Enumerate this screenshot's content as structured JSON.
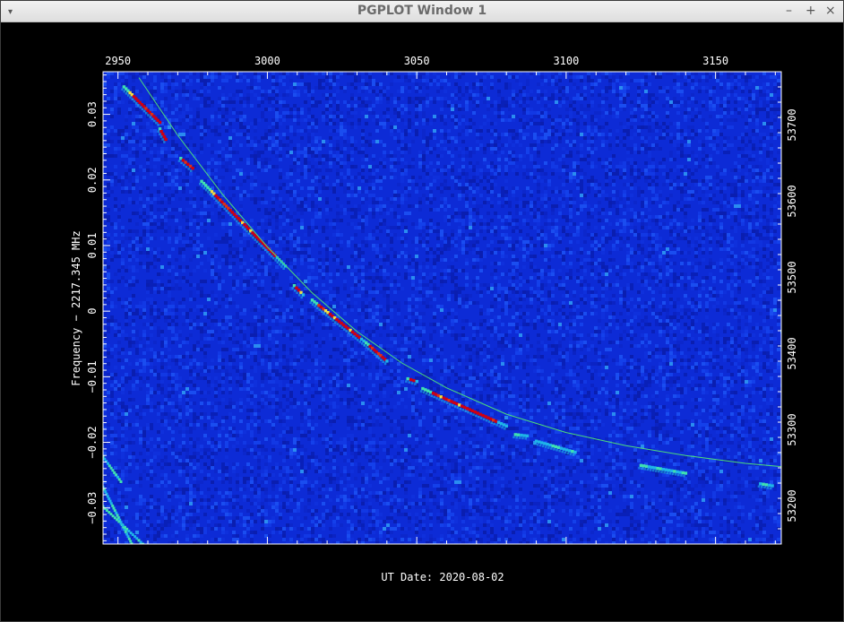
{
  "window": {
    "title": "PGPLOT Window 1",
    "menu_icon": "chevron-down-icon",
    "minimize_icon": "minimize-icon",
    "maximize_icon": "maximize-icon",
    "close_icon": "close-icon",
    "menu_glyph": "▾",
    "minimize_glyph": "–",
    "maximize_glyph": "+",
    "close_glyph": "×"
  },
  "chart_data": {
    "type": "heatmap",
    "title": "",
    "xlabel": "UT Date: 2020-08-02",
    "ylabel": "Frequency − 2217.345 MHz",
    "y2label": "",
    "xlim": [
      2945,
      3172
    ],
    "ylim": [
      -0.0355,
      0.0365
    ],
    "y2lim": [
      53150,
      53770
    ],
    "x_ticks": [
      "2950",
      "3000",
      "3050",
      "3100",
      "3150"
    ],
    "x_tick_values": [
      2950,
      3000,
      3050,
      3100,
      3150
    ],
    "y_ticks": [
      "−0.03",
      "−0.02",
      "−0.01",
      "0",
      "0.01",
      "0.02",
      "0.03"
    ],
    "y_tick_values": [
      -0.03,
      -0.02,
      -0.01,
      0,
      0.01,
      0.02,
      0.03
    ],
    "y2_ticks": [
      "53200",
      "53300",
      "53400",
      "53500",
      "53600",
      "53700"
    ],
    "y2_tick_values": [
      53200,
      53300,
      53400,
      53500,
      53600,
      53700
    ],
    "colors": {
      "background": "#0d2bd6",
      "model_curve": "#4ddc7a",
      "axes": "#ffffff",
      "colormap": [
        "#0b1fb8",
        "#1d5cf0",
        "#1fb4e8",
        "#3fe0b0",
        "#f0e040",
        "#e03010",
        "#d00010"
      ]
    },
    "model_curve": {
      "x": [
        2957,
        2970,
        2985,
        3000,
        3015,
        3030,
        3045,
        3060,
        3080,
        3100,
        3120,
        3140,
        3160,
        3172
      ],
      "y": [
        0.0356,
        0.0268,
        0.0178,
        0.0098,
        0.0028,
        -0.0031,
        -0.0079,
        -0.0117,
        -0.0157,
        -0.0185,
        -0.0205,
        -0.022,
        -0.0232,
        -0.0237
      ]
    },
    "signal_segments": [
      {
        "x": [
          2952,
          2964
        ],
        "y": [
          0.0342,
          0.0288
        ]
      },
      {
        "x": [
          2964,
          2966
        ],
        "y": [
          0.0278,
          0.0262
        ]
      },
      {
        "x": [
          2971,
          2975
        ],
        "y": [
          0.0233,
          0.0218
        ]
      },
      {
        "x": [
          2978,
          3006
        ],
        "y": [
          0.0198,
          0.0069
        ]
      },
      {
        "x": [
          3009,
          3012
        ],
        "y": [
          0.0039,
          0.0025
        ]
      },
      {
        "x": [
          3015,
          3033
        ],
        "y": [
          0.0017,
          -0.0048
        ]
      },
      {
        "x": [
          3033,
          3040
        ],
        "y": [
          -0.0048,
          -0.0076
        ]
      },
      {
        "x": [
          3047,
          3050
        ],
        "y": [
          -0.0103,
          -0.0107
        ]
      },
      {
        "x": [
          3052,
          3080
        ],
        "y": [
          -0.0118,
          -0.0175
        ]
      },
      {
        "x": [
          3083,
          3087
        ],
        "y": [
          -0.0188,
          -0.019
        ]
      },
      {
        "x": [
          3090,
          3103
        ],
        "y": [
          -0.0198,
          -0.0215
        ]
      },
      {
        "x": [
          3125,
          3140
        ],
        "y": [
          -0.0235,
          -0.0247
        ]
      },
      {
        "x": [
          3165,
          3169
        ],
        "y": [
          -0.0263,
          -0.0266
        ]
      }
    ],
    "corner_traces": [
      {
        "x": [
          2945,
          2955
        ],
        "y": [
          -0.0268,
          -0.0358
        ]
      },
      {
        "x": [
          2945,
          2959
        ],
        "y": [
          -0.0298,
          -0.0358
        ]
      },
      {
        "x": [
          2945,
          2951
        ],
        "y": [
          -0.0222,
          -0.026
        ]
      }
    ],
    "grid": false,
    "legend": "none"
  }
}
